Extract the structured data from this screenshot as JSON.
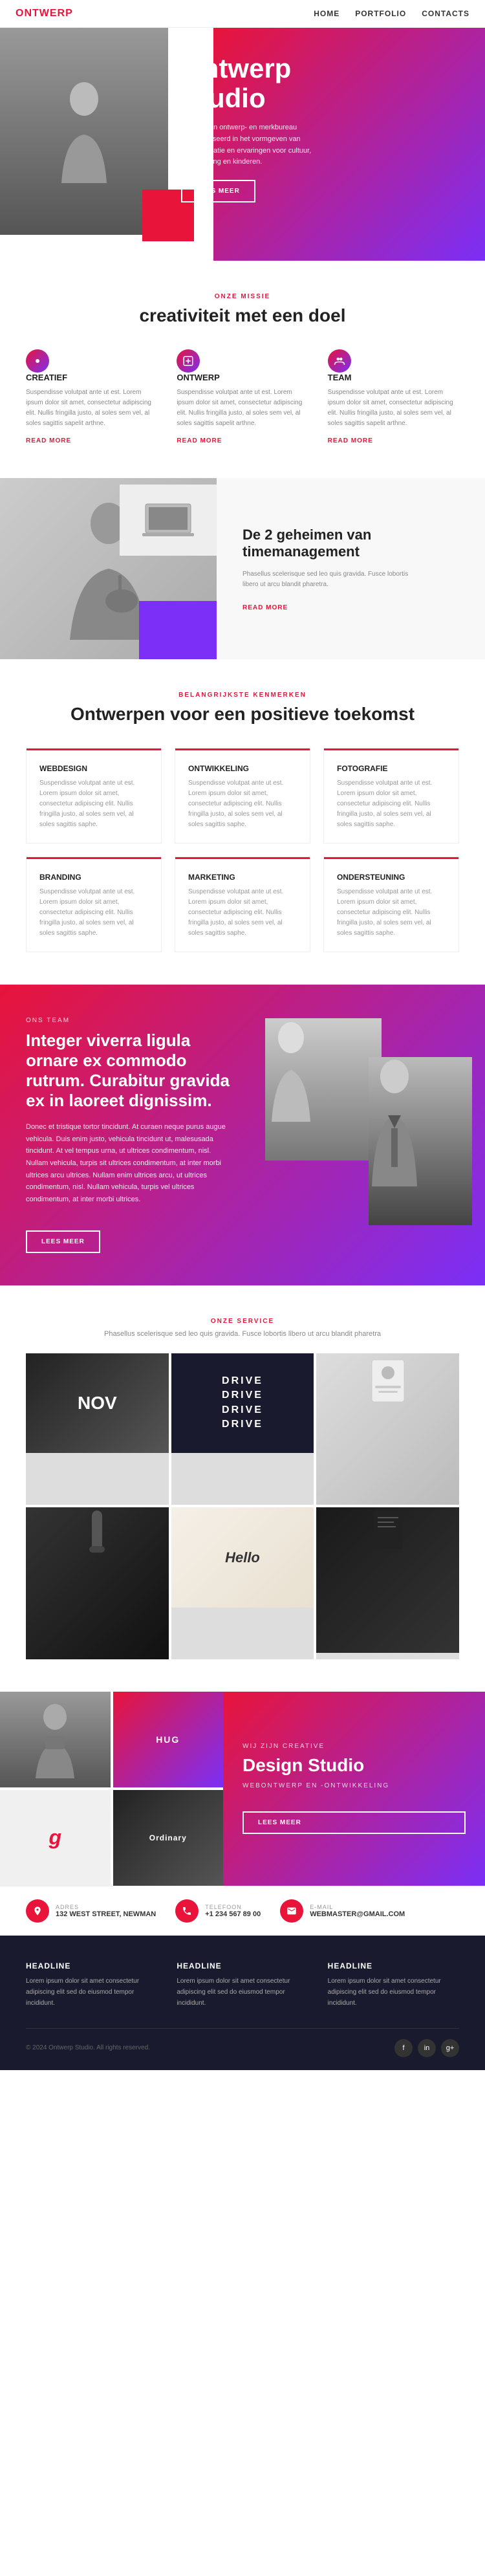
{
  "nav": {
    "logo": "ONTWERP",
    "links": [
      "HOME",
      "PORTFOLIO",
      "CONTACTS"
    ]
  },
  "hero": {
    "title_line1": "Ontwerp",
    "title_line2": "Studio",
    "description": "Wij zijn een ontwerp- en merkbureau gespecialiseerd in het vormgeven van communicatie en ervaringen voor cultuur, samenleving en kinderen.",
    "cta": "LEES MEER"
  },
  "mission": {
    "label": "ONZE MISSIE",
    "title": "creativiteit met een doel",
    "items": [
      {
        "icon": "target-icon",
        "title": "CREATIEF",
        "text": "Suspendisse volutpat ante ut est. Lorem ipsum dolor sit amet, consectetur adipiscing elit. Nullis fringilla justo, al soles sem vel, al soles sagittis sapelit arthne.",
        "link": "READ MORE"
      },
      {
        "icon": "design-icon",
        "title": "ONTWERP",
        "text": "Suspendisse volutpat ante ut est. Lorem ipsum dolor sit amet, consectetur adipiscing elit. Nullis fringilla justo, al soles sem vel, al soles sagittis sapelit arthne.",
        "link": "READ MORE"
      },
      {
        "icon": "team-icon",
        "title": "TEAM",
        "text": "Suspendisse volutpat ante ut est. Lorem ipsum dolor sit amet, consectetur adipiscing elit. Nullis fringilla justo, al soles sem vel, al soles sagittis sapelit arthne.",
        "link": "READ MORE"
      }
    ]
  },
  "split": {
    "title": "De 2 geheimen van timemanagement",
    "text": "Phasellus scelerisque sed leo quis gravida. Fusce lobortis libero ut arcu blandit pharetra.",
    "link": "READ MORE"
  },
  "features": {
    "label": "BELANGRIJKSTE KENMERKEN",
    "title": "Ontwerpen voor een positieve toekomst",
    "items": [
      {
        "title": "WEBDESIGN",
        "text": "Suspendisse volutpat ante ut est. Lorem ipsum dolor sit amet, consectetur adipiscing elit. Nullis fringilla justo, al soles sem vel, al soles sagittis saphe."
      },
      {
        "title": "ONTWIKKELING",
        "text": "Suspendisse volutpat ante ut est. Lorem ipsum dolor sit amet, consectetur adipiscing elit. Nullis fringilla justo, al soles sem vel, al soles sagittis saphe."
      },
      {
        "title": "FOTOGRAFIE",
        "text": "Suspendisse volutpat ante ut est. Lorem ipsum dolor sit amet, consectetur adipiscing elit. Nullis fringilla justo, al soles sem vel, al soles sagittis saphe."
      },
      {
        "title": "BRANDING",
        "text": "Suspendisse volutpat ante ut est. Lorem ipsum dolor sit amet, consectetur adipiscing elit. Nullis fringilla justo, al soles sem vel, al soles sagittis saphe."
      },
      {
        "title": "MARKETING",
        "text": "Suspendisse volutpat ante ut est. Lorem ipsum dolor sit amet, consectetur adipiscing elit. Nullis fringilla justo, al soles sem vel, al soles sagittis saphe."
      },
      {
        "title": "ONDERSTEUNING",
        "text": "Suspendisse volutpat ante ut est. Lorem ipsum dolor sit amet, consectetur adipiscing elit. Nullis fringilla justo, al soles sem vel, al soles sagittis saphe."
      }
    ]
  },
  "team": {
    "label": "Ons team",
    "title": "Integer viverra ligula ornare ex commodo rutrum. Curabitur gravida ex in laoreet dignissim.",
    "text1": "Donec et tristique tortor tincidunt. At curaen neque purus augue vehicula. Duis enim justo, vehicula tincidunt ut, malesusada tincidunt. At vel tempus urna, ut ultrices condimentum, nisl. Nullam vehicula, turpis sit ultrices condimentum, at inter morbi ultrices arcu ultrices. Nullam enim ultrices arcu, ut ultrices condimentum, nisl. Nullam vehicula, turpis vel ultrices condimentum, at inter morbi ultrices.",
    "cta": "LEES MEER"
  },
  "services": {
    "label": "Onze service",
    "subtitle": "Phasellus scelerisque sed leo quis gravida. Fusce lobortis libero ut arcu blandit pharetra",
    "drive_lines": [
      "DRIVE",
      "DRIVE",
      "DRIVE",
      "DRIVE"
    ]
  },
  "creative": {
    "subtitle": "Wij zijn Creative",
    "title": "Design Studio",
    "tagline": "WEBONTWERP EN -ONTWIKKELING",
    "cta": "LEES MEER"
  },
  "contact": {
    "items": [
      {
        "icon": "location-icon",
        "label": "ADRES",
        "value": "132 WEST STREET, NEWMAN"
      },
      {
        "icon": "phone-icon",
        "label": "TELEFOON",
        "value": "+1 234 567 89 00"
      },
      {
        "icon": "email-icon",
        "label": "E-MAIL",
        "value": "WEBMASTER@GMAIL.COM"
      }
    ]
  },
  "footer": {
    "cols": [
      {
        "title": "HEADLINE",
        "text": "Lorem ipsum dolor sit amet consectetur adipiscing elit sed do eiusmod tempor incididunt."
      },
      {
        "title": "HEADLINE",
        "text": "Lorem ipsum dolor sit amet consectetur adipiscing elit sed do eiusmod tempor incididunt."
      },
      {
        "title": "HEADLINE",
        "text": "Lorem ipsum dolor sit amet consectetur adipiscing elit sed do eiusmod tempor incididunt."
      }
    ],
    "copyright": "© 2024 Ontwerp Studio. All rights reserved.",
    "social": [
      "f",
      "in",
      "gp"
    ]
  }
}
